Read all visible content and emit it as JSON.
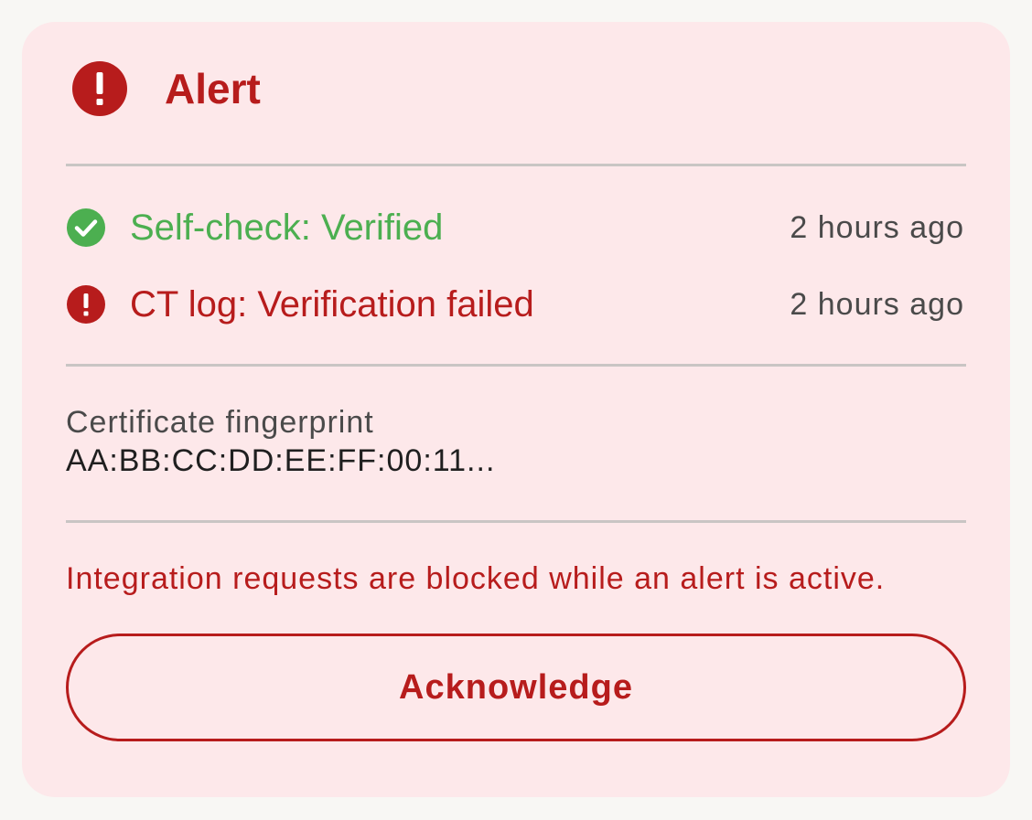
{
  "alert": {
    "title": "Alert",
    "icon": "error-icon",
    "color": "#b71c1c"
  },
  "checks": [
    {
      "label": "Self-check: Verified",
      "time": "2 hours ago",
      "status": "ok",
      "icon": "check-circle-icon",
      "color": "#4caf50"
    },
    {
      "label": "CT log: Verification failed",
      "time": "2 hours ago",
      "status": "fail",
      "icon": "error-icon",
      "color": "#b71c1c"
    }
  ],
  "fingerprint": {
    "label": "Certificate fingerprint",
    "value": "AA:BB:CC:DD:EE:FF:00:11..."
  },
  "notice": "Integration requests are blocked while an alert is active.",
  "actions": {
    "acknowledge_label": "Acknowledge"
  },
  "colors": {
    "card_background": "#fde8ea",
    "page_background": "#f8f7f4",
    "divider": "#c9c5c4"
  }
}
